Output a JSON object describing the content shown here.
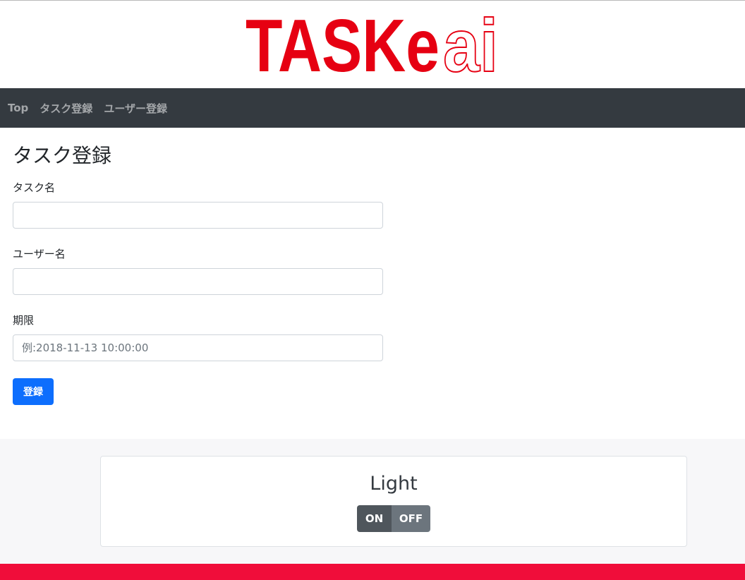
{
  "logo": {
    "text_red": "TASKe",
    "text_outline": "ai",
    "color": "#e60012"
  },
  "nav": {
    "items": [
      {
        "label": "Top"
      },
      {
        "label": "タスク登録"
      },
      {
        "label": "ユーザー登録"
      }
    ]
  },
  "main": {
    "title": "タスク登録",
    "fields": [
      {
        "label": "タスク名",
        "value": "",
        "placeholder": ""
      },
      {
        "label": "ユーザー名",
        "value": "",
        "placeholder": ""
      },
      {
        "label": "期限",
        "value": "",
        "placeholder": "例:2018-11-13 10:00:00"
      }
    ],
    "submit_label": "登録",
    "submit_color": "#0d6efd"
  },
  "light": {
    "title": "Light",
    "on_label": "ON",
    "off_label": "OFF"
  },
  "colors": {
    "navbar": "#343a40",
    "footer_bar": "#f00d3a"
  }
}
